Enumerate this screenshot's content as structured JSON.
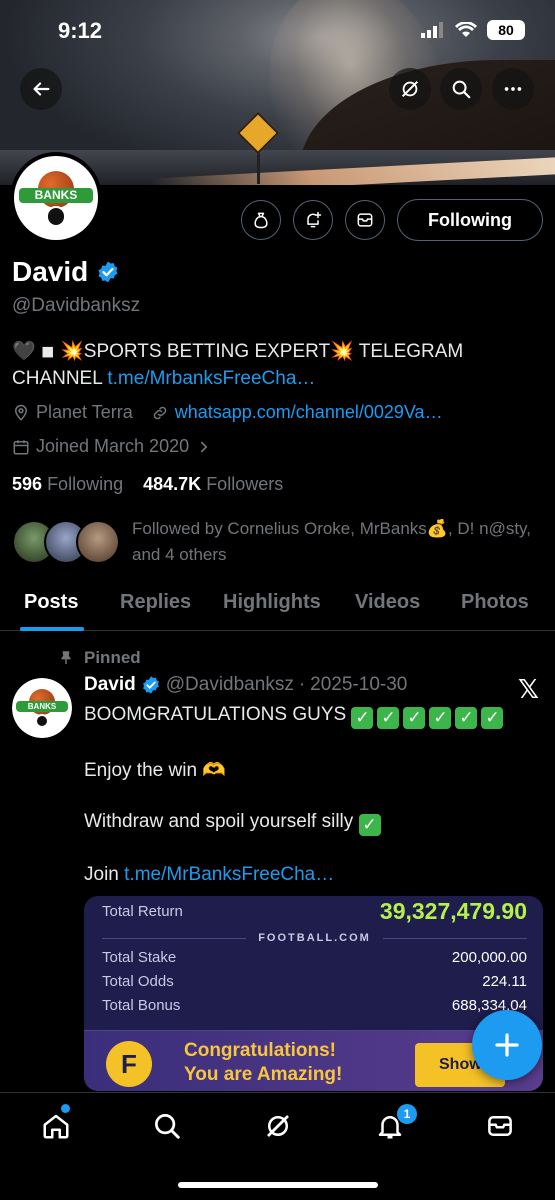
{
  "status_bar": {
    "time": "9:12",
    "battery": "80"
  },
  "profile": {
    "avatar_text": "BANKS",
    "name": "David",
    "handle": "@Davidbanksz",
    "follow_label": "Following",
    "bio_prefix": "🖤 ◾ 💥SPORTS BETTING EXPERT💥 TELEGRAM CHANNEL ",
    "bio_link": "t.me/MrbanksFreeCha…",
    "location": "Planet Terra",
    "website": "whatsapp.com/channel/0029Va…",
    "joined": "Joined March 2020",
    "following_count": "596",
    "following_label": "Following",
    "followers_count": "484.7K",
    "followers_label": "Followers",
    "followed_by": "Followed by Cornelius Oroke, MrBanks💰, D! n@sty, and 4 others"
  },
  "tabs": [
    "Posts",
    "Replies",
    "Highlights",
    "Videos",
    "Photos"
  ],
  "post": {
    "pinned_label": "Pinned",
    "author": "David",
    "handle": "@Davidbanksz",
    "sep": "·",
    "date": "2025-10-30",
    "line1": "BOOMGRATULATIONS GUYS",
    "line2": "Enjoy the win 🫶",
    "line3": "Withdraw and spoil yourself silly",
    "line4_prefix": "Join ",
    "line4_link": "t.me/MrBanksFreeCha…"
  },
  "bet_card": {
    "total_return_label": "Total Return",
    "total_return": "39,327,479.90",
    "brand": "FOOTBALL.COM",
    "total_stake_label": "Total Stake",
    "total_stake": "200,000.00",
    "total_odds_label": "Total Odds",
    "total_odds": "224.11",
    "total_bonus_label": "Total Bonus",
    "total_bonus": "688,334.04",
    "promo_line1": "Congratulations!",
    "promo_line2": "You are Amazing!",
    "show_label": "Show"
  },
  "notifications_badge": "1",
  "colors": {
    "accent": "#1d9bf0",
    "background": "#000000",
    "muted": "#71767b",
    "card": "#1e1d4c",
    "return_green": "#b6f04a"
  }
}
